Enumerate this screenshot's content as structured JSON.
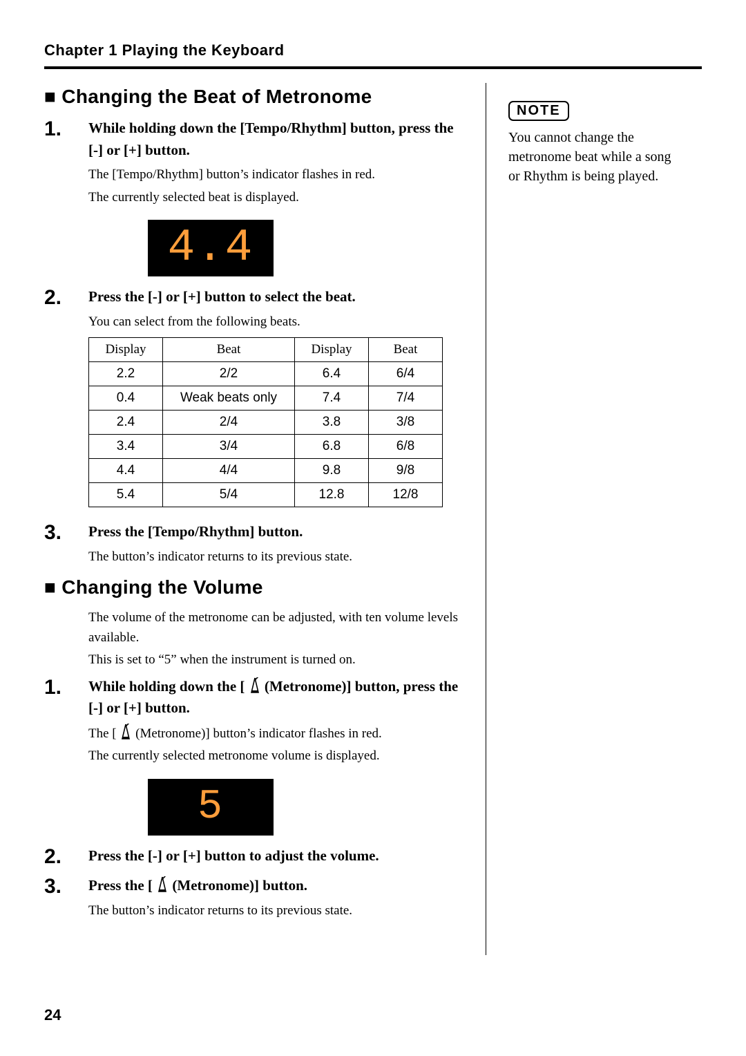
{
  "chapter": "Chapter 1 Playing the Keyboard",
  "page_number": "24",
  "side": {
    "note_label": "NOTE",
    "note_text": "You cannot change the metronome beat while a song or Rhythm is being played."
  },
  "section1": {
    "heading": "Changing the Beat of Metronome",
    "step1": {
      "num": "1.",
      "title": "While holding down the [Tempo/Rhythm] button, press the [-] or [+] button.",
      "line1": "The [Tempo/Rhythm] button’s indicator flashes in red.",
      "line2": "The currently selected beat is displayed.",
      "display": "4.4"
    },
    "step2": {
      "num": "2.",
      "title": "Press the [-] or [+] button to select the beat.",
      "line1": "You can select from the following beats.",
      "table": {
        "headers": [
          "Display",
          "Beat",
          "Display",
          "Beat"
        ],
        "rows": [
          [
            "2.2",
            "2/2",
            "6.4",
            "6/4"
          ],
          [
            "0.4",
            "Weak beats only",
            "7.4",
            "7/4"
          ],
          [
            "2.4",
            "2/4",
            "3.8",
            "3/8"
          ],
          [
            "3.4",
            "3/4",
            "6.8",
            "6/8"
          ],
          [
            "4.4",
            "4/4",
            "9.8",
            "9/8"
          ],
          [
            "5.4",
            "5/4",
            "12.8",
            "12/8"
          ]
        ]
      }
    },
    "step3": {
      "num": "3.",
      "title": "Press the [Tempo/Rhythm] button.",
      "line1": "The button’s indicator returns to its previous state."
    }
  },
  "section2": {
    "heading": "Changing the Volume",
    "intro1": "The volume of the metronome can be adjusted, with ten volume levels available.",
    "intro2": "This is set to “5” when the instrument is turned on.",
    "step1": {
      "num": "1.",
      "title_pre": "While holding down the [",
      "title_post": " (Metronome)] button, press the [-] or [+] button.",
      "line1_pre": "The [",
      "line1_post": " (Metronome)] button’s indicator flashes in red.",
      "line2": "The currently selected metronome volume is displayed.",
      "display": "5"
    },
    "step2": {
      "num": "2.",
      "title": "Press the [-] or [+] button to adjust the volume."
    },
    "step3": {
      "num": "3.",
      "title_pre": "Press the [",
      "title_post": " (Metronome)] button.",
      "line1": "The button’s indicator returns to its previous state."
    }
  }
}
